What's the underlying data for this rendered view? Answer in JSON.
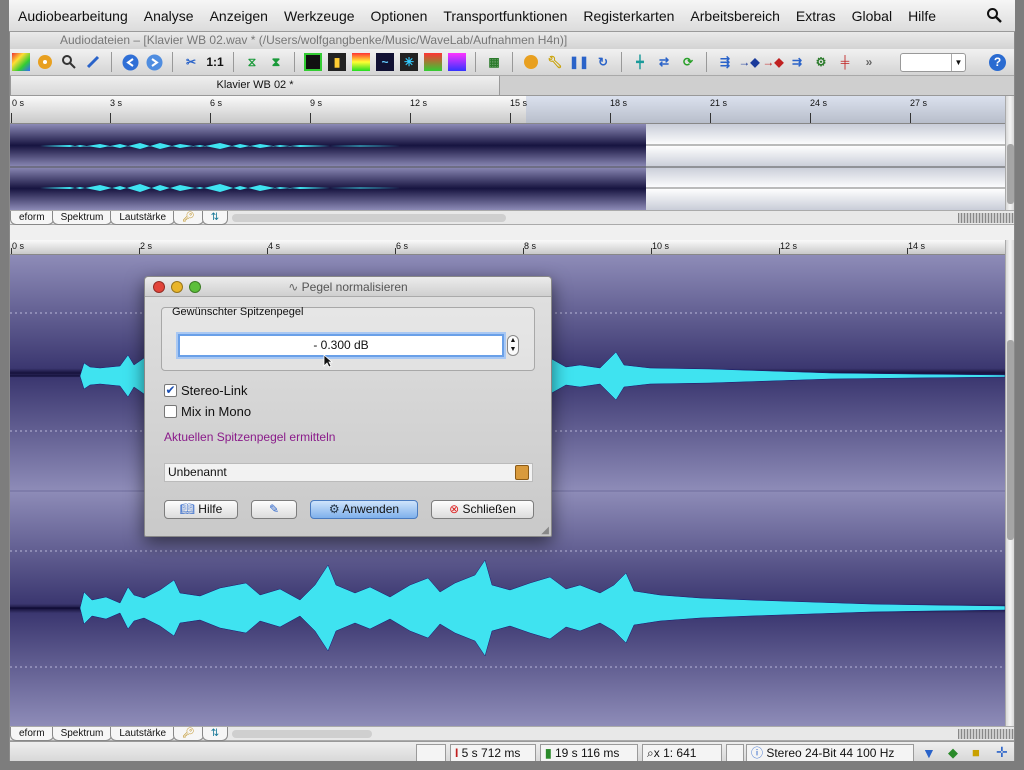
{
  "menubar": {
    "items": [
      "Audiobearbeitung",
      "Analyse",
      "Anzeigen",
      "Werkzeuge",
      "Optionen",
      "Transportfunktionen",
      "Registerkarten",
      "Arbeitsbereich",
      "Extras",
      "Global",
      "Hilfe"
    ]
  },
  "window": {
    "title": "Audiodateien – [Klavier WB 02.wav * (/Users/wolfgangbenke/Music/WaveLab/Aufnahmen H4n)]"
  },
  "document_tab": {
    "label": "Klavier WB 02 *"
  },
  "overview_ruler": {
    "labels": [
      "0 s",
      "3 s",
      "6 s",
      "9 s",
      "12 s",
      "15 s",
      "18 s",
      "21 s",
      "24 s",
      "27 s"
    ]
  },
  "main_ruler": {
    "labels": [
      "0 s",
      "2 s",
      "4 s",
      "6 s",
      "8 s",
      "10 s",
      "12 s",
      "14 s"
    ]
  },
  "view_tabs_top": [
    "eform",
    "Spektrum",
    "Lautstärke"
  ],
  "view_tabs_bottom": [
    "eform",
    "Spektrum",
    "Lautstärke"
  ],
  "dialog": {
    "title": "Pegel normalisieren",
    "group_label": "Gewünschter Spitzenpegel",
    "peak_value": "- 0.300 dB",
    "stereo_link_label": "Stereo-Link",
    "stereo_link_checked": true,
    "mix_mono_label": "Mix in Mono",
    "mix_mono_checked": false,
    "detect_link": "Aktuellen Spitzenpegel ermitteln",
    "preset_name": "Unbenannt",
    "buttons": {
      "help": "Hilfe",
      "apply": "Anwenden",
      "close": "Schließen"
    }
  },
  "status": {
    "cursor": "5 s 712 ms",
    "length": "19 s 116 ms",
    "zoom": "x 1: 641",
    "format": "Stereo 24-Bit 44 100 Hz"
  },
  "colors": {
    "waveform": "#3fe3f0",
    "track_dark": "#1d1a4a",
    "track_light": "#8e8cb8",
    "accent_link": "#8a1b8a"
  }
}
